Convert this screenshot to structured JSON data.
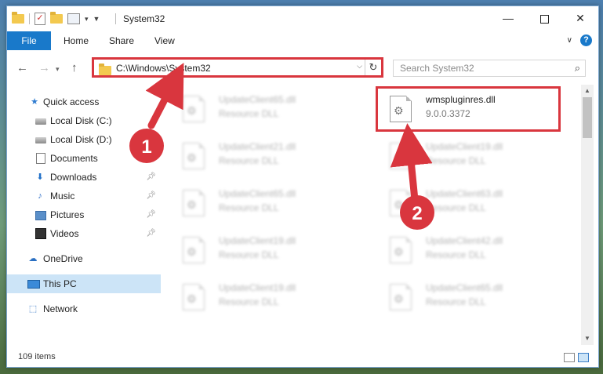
{
  "window": {
    "title": "System32",
    "controls": {
      "minimize": "—",
      "maximize": "",
      "close": "✕"
    }
  },
  "ribbon": {
    "tabs": [
      "File",
      "Home",
      "Share",
      "View"
    ]
  },
  "address": {
    "path": "C:\\Windows\\System32",
    "search_placeholder": "Search System32"
  },
  "sidebar": {
    "items": [
      {
        "label": "Quick access",
        "icon": "star-icon"
      },
      {
        "label": "Local Disk (C:)",
        "icon": "disk-icon"
      },
      {
        "label": "Local Disk (D:)",
        "icon": "disk-icon"
      },
      {
        "label": "Documents",
        "icon": "documents-icon"
      },
      {
        "label": "Downloads",
        "icon": "downloads-icon",
        "pinned": true
      },
      {
        "label": "Music",
        "icon": "music-icon",
        "pinned": true
      },
      {
        "label": "Pictures",
        "icon": "pictures-icon",
        "pinned": true
      },
      {
        "label": "Videos",
        "icon": "videos-icon",
        "pinned": true
      },
      {
        "label": "OneDrive",
        "icon": "onedrive-icon"
      },
      {
        "label": "This PC",
        "icon": "this-pc-icon",
        "selected": true
      },
      {
        "label": "Network",
        "icon": "network-icon"
      }
    ]
  },
  "files": {
    "left": [
      {
        "name": "UpdateClient65.dll",
        "desc": "Resource DLL"
      },
      {
        "name": "UpdateClient21.dll",
        "desc": "Resource DLL"
      },
      {
        "name": "UpdateClient65.dll",
        "desc": "Resource DLL"
      },
      {
        "name": "UpdateClient19.dll",
        "desc": "Resource DLL"
      },
      {
        "name": "UpdateClient19.dll",
        "desc": "Resource DLL"
      }
    ],
    "right": [
      {
        "name": "wmspluginres.dll",
        "desc": "9.0.0.3372",
        "focused": true
      },
      {
        "name": "UpdateClient19.dll",
        "desc": "Resource DLL"
      },
      {
        "name": "UpdateClient63.dll",
        "desc": "Resource DLL"
      },
      {
        "name": "UpdateClient42.dll",
        "desc": "Resource DLL"
      },
      {
        "name": "UpdateClient65.dll",
        "desc": "Resource DLL"
      }
    ]
  },
  "status": {
    "item_count": "109 items"
  },
  "annotations": {
    "step1": "1",
    "step2": "2",
    "color": "#d9363e"
  }
}
